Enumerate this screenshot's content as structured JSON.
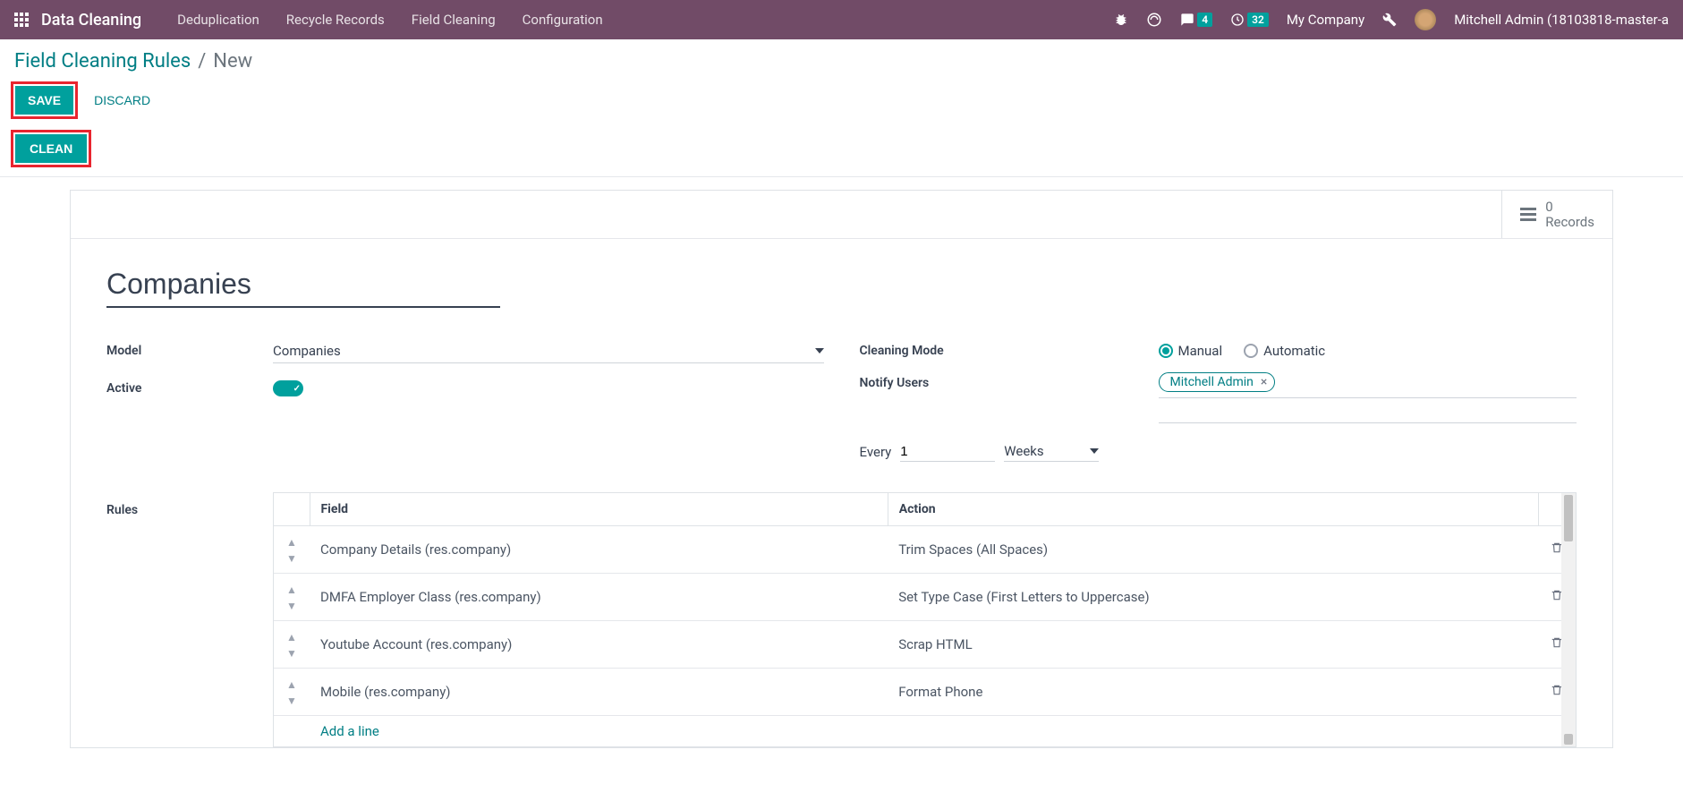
{
  "navbar": {
    "brand": "Data Cleaning",
    "menu": [
      "Deduplication",
      "Recycle Records",
      "Field Cleaning",
      "Configuration"
    ],
    "messages_badge": "4",
    "activities_badge": "32",
    "company": "My Company",
    "user": "Mitchell Admin (18103818-master-a"
  },
  "breadcrumb": {
    "parent": "Field Cleaning Rules",
    "current": "New"
  },
  "buttons": {
    "save": "SAVE",
    "discard": "DISCARD",
    "clean": "CLEAN"
  },
  "stat": {
    "count": "0",
    "label": "Records"
  },
  "form": {
    "title": "Companies",
    "model_label": "Model",
    "model_value": "Companies",
    "active_label": "Active",
    "cleaning_mode_label": "Cleaning Mode",
    "mode_manual": "Manual",
    "mode_automatic": "Automatic",
    "notify_label": "Notify Users",
    "notify_tag": "Mitchell Admin",
    "interval_every": "Every",
    "interval_value": "1",
    "interval_unit": "Weeks"
  },
  "rules": {
    "label": "Rules",
    "headers": {
      "field": "Field",
      "action": "Action"
    },
    "rows": [
      {
        "field": "Company Details (res.company)",
        "action": "Trim Spaces (All Spaces)"
      },
      {
        "field": "DMFA Employer Class (res.company)",
        "action": "Set Type Case (First Letters to Uppercase)"
      },
      {
        "field": "Youtube Account (res.company)",
        "action": "Scrap HTML"
      },
      {
        "field": "Mobile (res.company)",
        "action": "Format Phone"
      }
    ],
    "add_line": "Add a line"
  }
}
